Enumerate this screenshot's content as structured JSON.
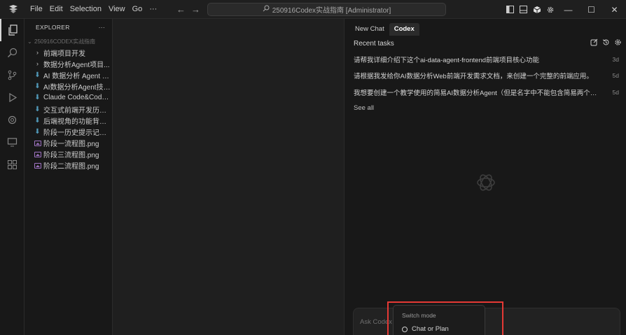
{
  "titlebar": {
    "menu": [
      {
        "label": "File"
      },
      {
        "label": "Edit"
      },
      {
        "label": "Selection"
      },
      {
        "label": "View"
      },
      {
        "label": "Go"
      }
    ],
    "more": "···",
    "back": "←",
    "forward": "→",
    "command_center": "250916Codex实战指南 [Administrator]",
    "window_controls": {
      "minimize": "—",
      "maximize": "☐",
      "close": "✕"
    }
  },
  "explorer": {
    "title": "EXPLORER",
    "more": "···",
    "root": "250916CODEX实战指南",
    "items": [
      {
        "type": "folder",
        "label": "前端项目开发"
      },
      {
        "type": "folder",
        "label": "数据分析Agent项目..."
      },
      {
        "type": "md",
        "label": "AI 数据分析 Agent W..."
      },
      {
        "type": "md",
        "label": "AI数据分析Agent技术..."
      },
      {
        "type": "md",
        "label": "Claude Code&Codex..."
      },
      {
        "type": "md",
        "label": "交互式前端开发历史..."
      },
      {
        "type": "md",
        "label": "后端视角的功能背景..."
      },
      {
        "type": "md",
        "label": "阶段一历史提示记录..."
      },
      {
        "type": "png",
        "label": "阶段一流程图.png"
      },
      {
        "type": "png",
        "label": "阶段三流程图.png"
      },
      {
        "type": "png",
        "label": "阶段二流程图.png"
      }
    ]
  },
  "codex": {
    "tabs": [
      {
        "label": "New Chat",
        "active": false
      },
      {
        "label": "Codex",
        "active": true
      }
    ],
    "recent_title": "Recent tasks",
    "tasks": [
      {
        "text": "请帮我详细介绍下这个ai-data-agent-frontend前端项目核心功能",
        "age": "3d"
      },
      {
        "text": "请根据我发给你AI数据分析Web前端开发需求文档，来创建一个完整的前端应用。",
        "age": "5d"
      },
      {
        "text": "我想要创建一个教学使用的简易AI数据分析Agent（但是名字中不能包含简易两个字）",
        "age": "5d"
      }
    ],
    "see_all": "See all",
    "ask_placeholder": "Ask Codex to",
    "switch_mode": {
      "title": "Switch mode",
      "option": "Chat or Plan"
    }
  },
  "colors": {
    "highlight": "#e53935",
    "background": "#181818",
    "editor": "#1f1f1f"
  }
}
